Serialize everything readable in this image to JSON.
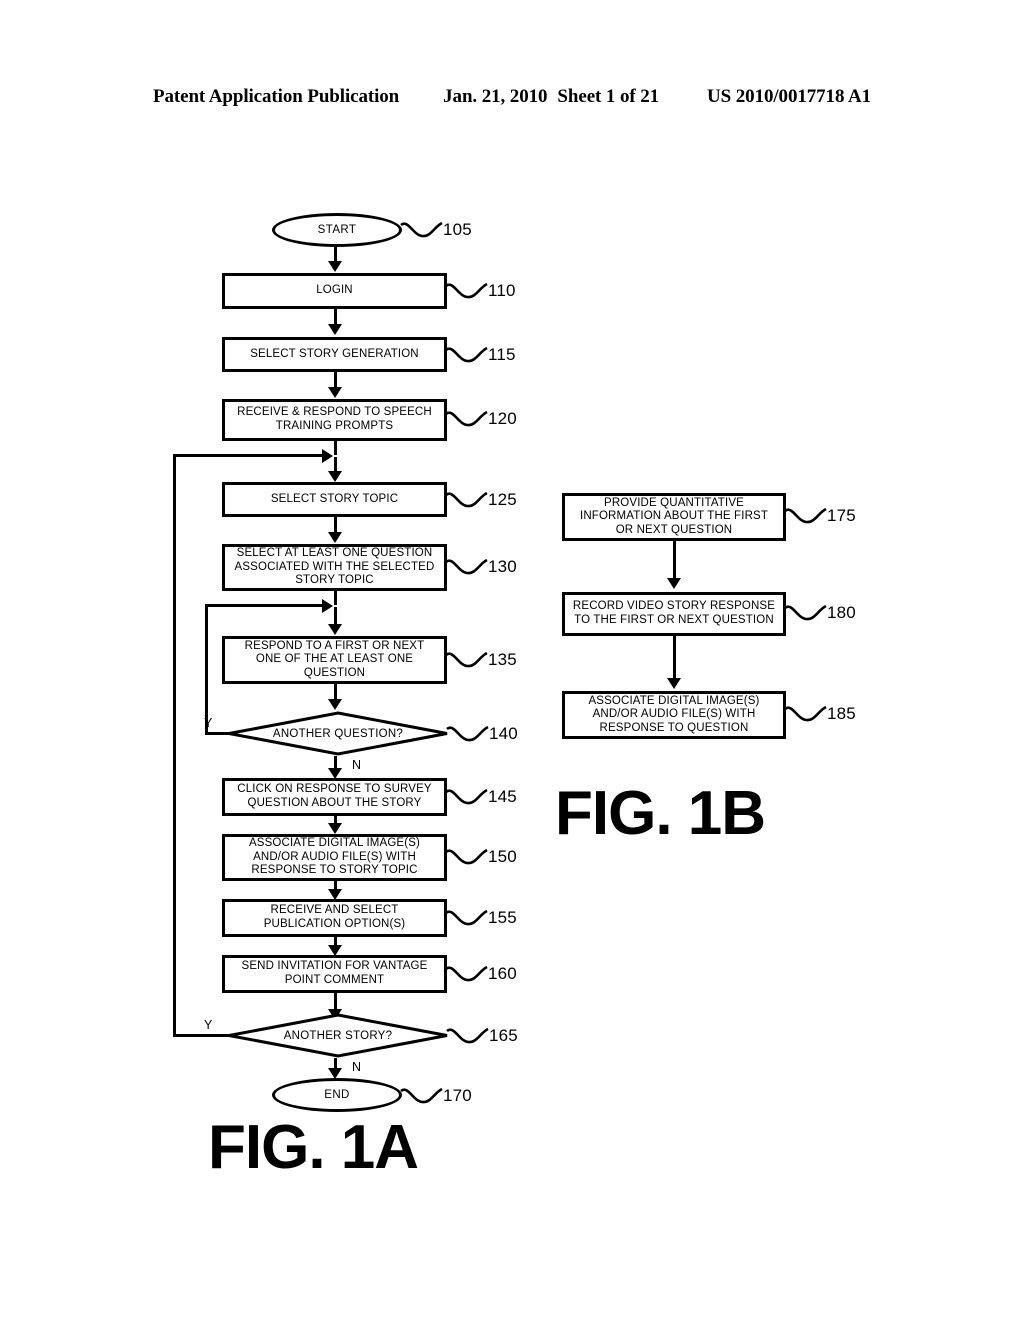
{
  "header": {
    "publication": "Patent Application Publication",
    "date": "Jan. 21, 2010",
    "sheet": "Sheet 1 of 21",
    "patent_number": "US 2010/0017718 A1"
  },
  "figures": [
    {
      "id": "fig-1a",
      "caption": "FIG. 1A"
    },
    {
      "id": "fig-1b",
      "caption": "FIG. 1B"
    }
  ],
  "fig1a": {
    "caption": "FIG. 1A",
    "nodes": [
      {
        "ref": "105",
        "shape": "terminator",
        "text": "START"
      },
      {
        "ref": "110",
        "shape": "process",
        "text": "LOGIN"
      },
      {
        "ref": "115",
        "shape": "process",
        "text": "SELECT STORY GENERATION"
      },
      {
        "ref": "120",
        "shape": "process",
        "line1": "RECEIVE & RESPOND TO SPEECH",
        "line2": "TRAINING PROMPTS"
      },
      {
        "ref": "125",
        "shape": "process",
        "text": "SELECT STORY TOPIC"
      },
      {
        "ref": "130",
        "shape": "process",
        "line1": "SELECT AT LEAST ONE QUESTION",
        "line2": "ASSOCIATED WITH THE SELECTED",
        "line3": "STORY TOPIC"
      },
      {
        "ref": "135",
        "shape": "process",
        "line1": "RESPOND TO A FIRST OR NEXT",
        "line2": "ONE OF THE AT LEAST ONE",
        "line3": "QUESTION"
      },
      {
        "ref": "140",
        "shape": "decision",
        "text": "ANOTHER QUESTION?",
        "yes_label": "Y",
        "no_label": "N"
      },
      {
        "ref": "145",
        "shape": "process",
        "line1": "CLICK ON RESPONSE TO SURVEY",
        "line2": "QUESTION ABOUT THE STORY"
      },
      {
        "ref": "150",
        "shape": "process",
        "line1": "ASSOCIATE DIGITAL IMAGE(S)",
        "line2": "AND/OR AUDIO FILE(S) WITH",
        "line3": "RESPONSE TO STORY TOPIC"
      },
      {
        "ref": "155",
        "shape": "process",
        "line1": "RECEIVE AND SELECT",
        "line2": "PUBLICATION OPTION(S)"
      },
      {
        "ref": "160",
        "shape": "process",
        "line1": "SEND INVITATION FOR VANTAGE",
        "line2": "POINT COMMENT"
      },
      {
        "ref": "165",
        "shape": "decision",
        "text": "ANOTHER STORY?",
        "yes_label": "Y",
        "no_label": "N"
      },
      {
        "ref": "170",
        "shape": "terminator",
        "text": "END"
      }
    ]
  },
  "fig1b": {
    "caption": "FIG. 1B",
    "nodes": [
      {
        "ref": "175",
        "shape": "process",
        "line1": "PROVIDE QUANTITATIVE",
        "line2": "INFORMATION ABOUT THE FIRST",
        "line3": "OR NEXT QUESTION"
      },
      {
        "ref": "180",
        "shape": "process",
        "line1": "RECORD VIDEO STORY RESPONSE",
        "line2": "TO THE FIRST OR NEXT QUESTION"
      },
      {
        "ref": "185",
        "shape": "process",
        "line1": "ASSOCIATE DIGITAL IMAGE(S)",
        "line2": "AND/OR AUDIO FILE(S) WITH",
        "line3": "RESPONSE TO QUESTION"
      }
    ]
  },
  "colors": {
    "ink": "#000000",
    "paper": "#ffffff"
  }
}
